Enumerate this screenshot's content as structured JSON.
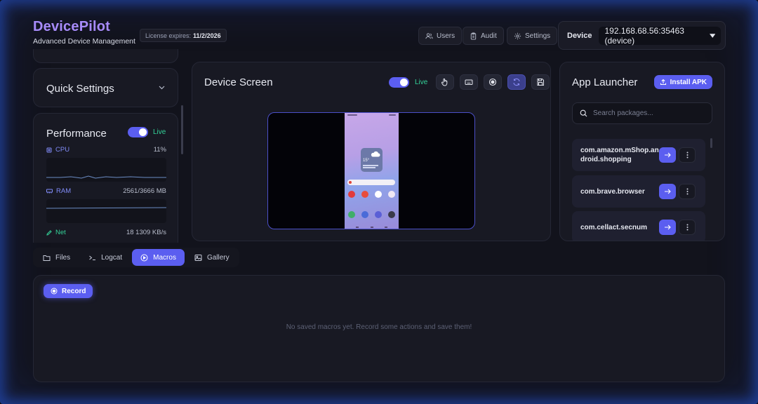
{
  "header": {
    "brand_title": "DevicePilot",
    "brand_subtitle": "Advanced Device Management",
    "license_label": "License expires:",
    "license_date": "11/2/2026",
    "buttons": {
      "users": "Users",
      "audit": "Audit",
      "settings": "Settings"
    },
    "device_label": "Device",
    "device_value": "192.168.68.56:35463 (device)"
  },
  "sidebar": {
    "quick_settings": "Quick Settings",
    "performance_title": "Performance",
    "live_label": "Live",
    "metrics": [
      {
        "name": "CPU",
        "value": "11%"
      },
      {
        "name": "RAM",
        "value": "2561/3666 MB"
      },
      {
        "name": "Net",
        "value": "18 1309 KB/s"
      }
    ]
  },
  "device_screen": {
    "title": "Device Screen",
    "live_label": "Live",
    "weather_temp": "15°"
  },
  "app_launcher": {
    "title": "App Launcher",
    "install_label": "Install APK",
    "search_placeholder": "Search packages...",
    "packages": [
      {
        "name": "com.amazon.mShop.android.shopping"
      },
      {
        "name": "com.brave.browser"
      },
      {
        "name": "com.cellact.secnum"
      }
    ]
  },
  "tabs": [
    {
      "label": "Files",
      "icon": "folder-icon"
    },
    {
      "label": "Logcat",
      "icon": "terminal-icon"
    },
    {
      "label": "Macros",
      "icon": "play-circle-icon",
      "active": true
    },
    {
      "label": "Gallery",
      "icon": "image-icon"
    }
  ],
  "macros": {
    "record_label": "Record",
    "empty_message": "No saved macros yet. Record some actions and save them!"
  },
  "colors": {
    "accent": "#5b5ef0",
    "brand": "#a78bfa",
    "live": "#34d399"
  }
}
